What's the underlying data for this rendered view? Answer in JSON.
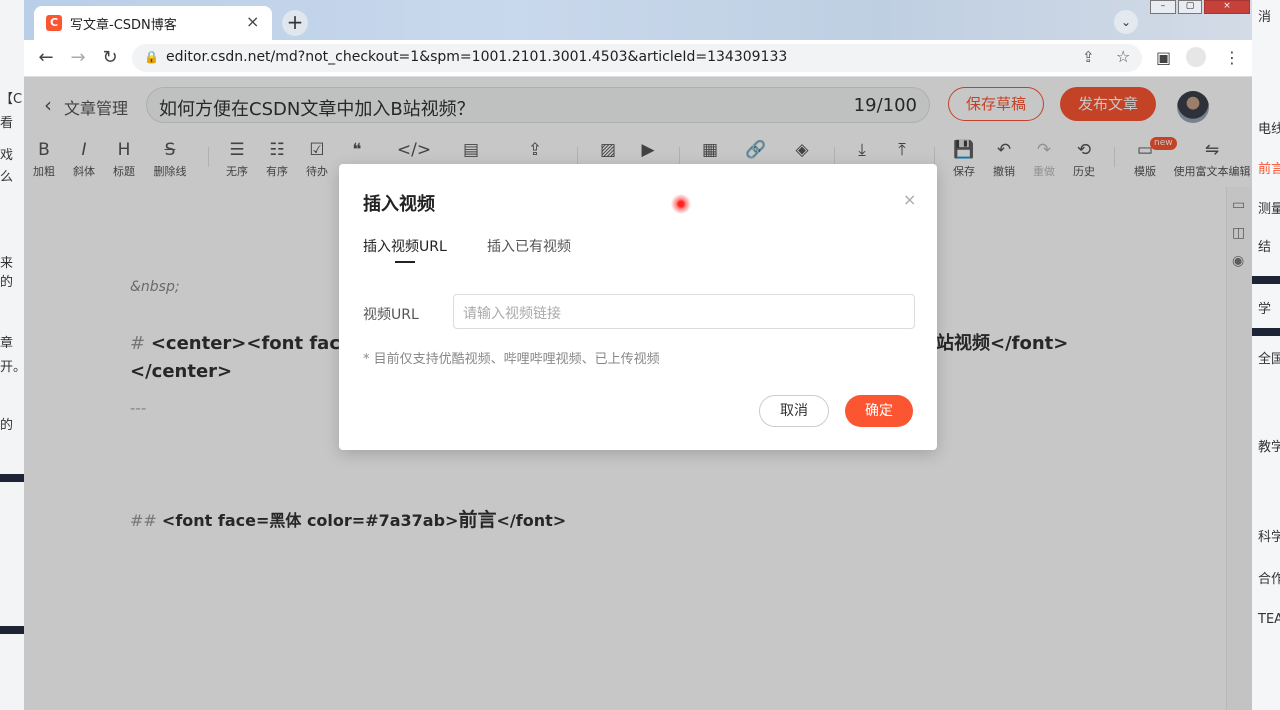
{
  "browser": {
    "tab_title": "写文章-CSDN博客",
    "favicon_letter": "C",
    "new_tab": "+",
    "tab_close": "×",
    "url": "editor.csdn.net/md?not_checkout=1&spm=1001.2101.3001.4503&articleId=134309133"
  },
  "editor": {
    "back_label": "文章管理",
    "title": "如何方便在CSDN文章中加入B站视频？",
    "title_count": "19/100",
    "save_draft": "保存草稿",
    "publish": "发布文章"
  },
  "toolbar": {
    "items": [
      {
        "icon": "B",
        "label": "加粗"
      },
      {
        "icon": "I",
        "label": "斜体"
      },
      {
        "icon": "H",
        "label": "标题"
      },
      {
        "icon": "S",
        "label": "删除线"
      },
      {
        "icon": "☰",
        "label": "无序"
      },
      {
        "icon": "☷",
        "label": "有序"
      },
      {
        "icon": "☑",
        "label": "待办"
      },
      {
        "icon": "❝",
        "label": ""
      },
      {
        "icon": "</>",
        "label": ""
      },
      {
        "icon": "▤",
        "label": ""
      },
      {
        "icon": "⇪",
        "label": ""
      },
      {
        "icon": "▨",
        "label": ""
      },
      {
        "icon": "▶",
        "label": ""
      },
      {
        "icon": "▦",
        "label": ""
      },
      {
        "icon": "🔗",
        "label": ""
      },
      {
        "icon": "◈",
        "label": ""
      },
      {
        "icon": "⤓",
        "label": ""
      },
      {
        "icon": "⤒",
        "label": ""
      },
      {
        "icon": "💾",
        "label": "保存"
      },
      {
        "icon": "↶",
        "label": "撤销"
      },
      {
        "icon": "↷",
        "label": "重做"
      },
      {
        "icon": "⟲",
        "label": "历史"
      },
      {
        "icon": "▭",
        "label": "模版"
      },
      {
        "icon": "⇋",
        "label": "使用富文本编辑"
      }
    ],
    "new_badge": "new"
  },
  "content": {
    "line1": "&nbsp;",
    "line2_hash": "#",
    "line2_left": "<center><font face=楷",
    "line2_right": "站视频</font>",
    "line3": "</center>",
    "line4": "---",
    "line5_hash": "##",
    "line5_a": "<font face=黑体 color=#7a37ab>",
    "line5_b": "前言",
    "line5_c": "</font>"
  },
  "modal": {
    "title": "插入视频",
    "close": "×",
    "tab_url": "插入视频URL",
    "tab_existing": "插入已有视频",
    "url_label": "视频URL",
    "url_placeholder": "请输入视频链接",
    "support_note": "* 目前仅支持优酷视频、哔哩哔哩视频、已上传视频",
    "cancel": "取消",
    "confirm": "确定"
  },
  "right_edge_fragments": [
    "消",
    "电线",
    "前言",
    "测量",
    "结",
    "学",
    "全国",
    "教学",
    "科学",
    "合作",
    "TEA"
  ],
  "left_edge_fragments": [
    "【C",
    "看",
    "戏",
    "么",
    "来的",
    "章",
    "开。",
    "的"
  ],
  "colors": {
    "brand": "#fc5531"
  }
}
